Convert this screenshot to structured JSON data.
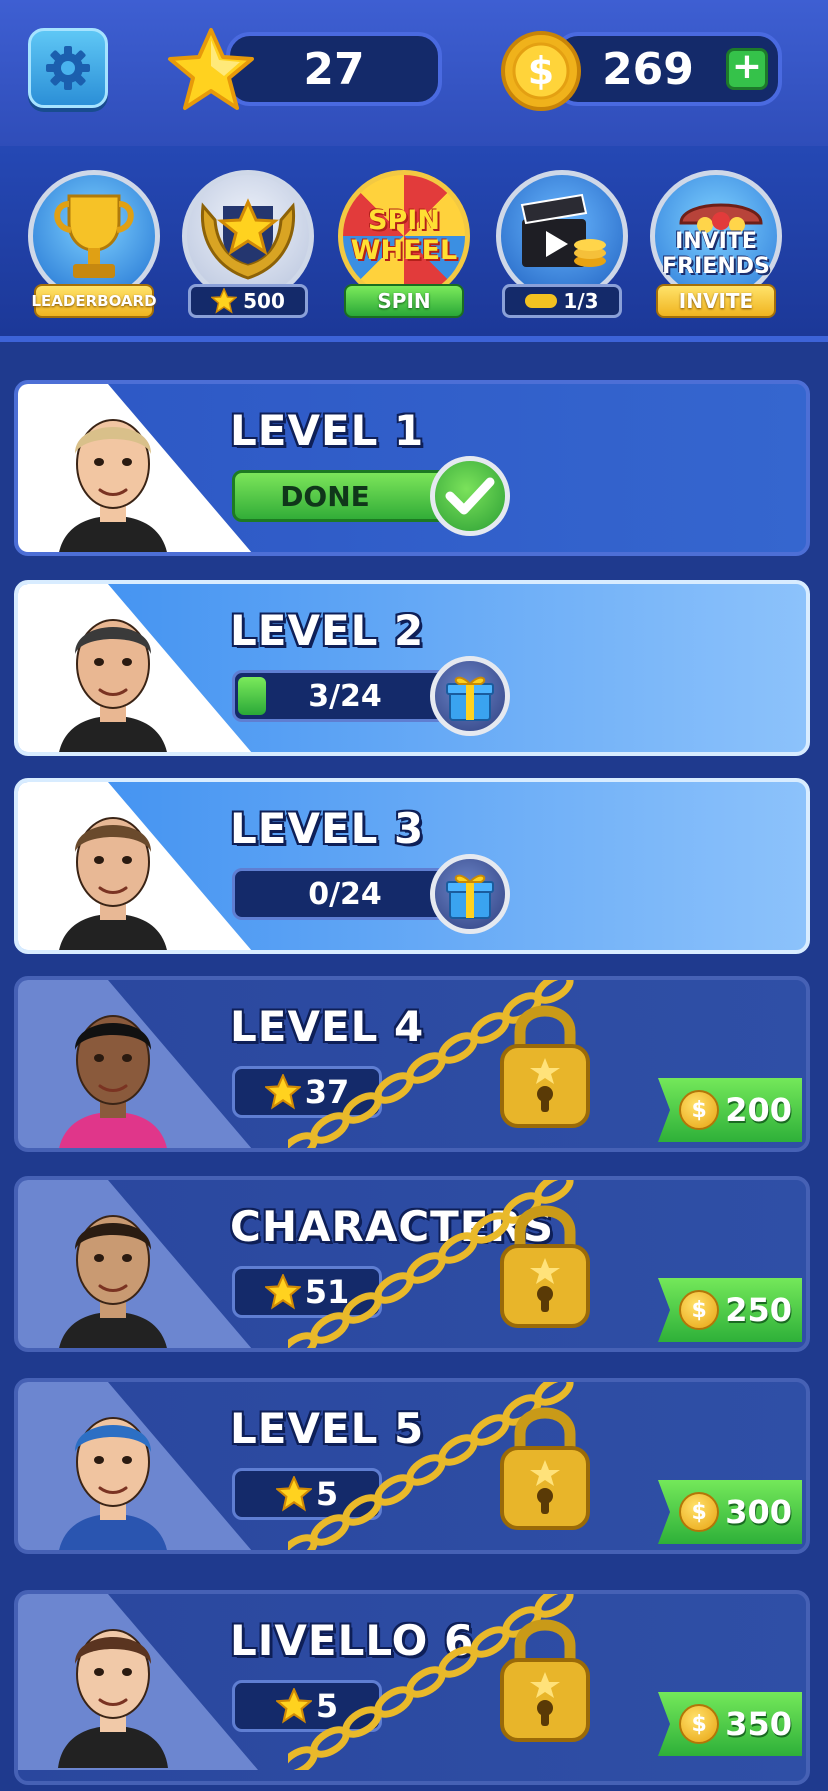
{
  "header": {
    "stars": "27",
    "coins": "269",
    "plus": "+"
  },
  "features": [
    {
      "pill": "LEADERBOARD",
      "icon": "trophy-icon"
    },
    {
      "pill": "500",
      "icon": "winged-star-badge-icon"
    },
    {
      "pill": "SPIN",
      "art_line1": "SPIN",
      "art_line2": "WHEEL",
      "icon": "spin-wheel-icon"
    },
    {
      "pill": "1/3",
      "icon": "video-coins-icon"
    },
    {
      "pill": "INVITE",
      "art_line1": "INVITE",
      "art_line2": "FRIENDS",
      "icon": "treasure-chest-icon"
    }
  ],
  "levels": [
    {
      "title": "LEVEL 1",
      "state": "done",
      "status": "DONE"
    },
    {
      "title": "LEVEL 2",
      "state": "active",
      "progress": "3/24",
      "progress_fraction": 0.125
    },
    {
      "title": "LEVEL 3",
      "state": "active",
      "progress": "0/24",
      "progress_fraction": 0
    },
    {
      "title": "LEVEL 4",
      "state": "locked",
      "stars": "37",
      "price": "200"
    },
    {
      "title": "CHARACTERS",
      "state": "locked",
      "stars": "51",
      "price": "250"
    },
    {
      "title": "LEVEL 5",
      "state": "locked",
      "stars": "5",
      "price": "300"
    },
    {
      "title": "LIVELLO 6",
      "state": "locked",
      "stars": "5",
      "price": "350"
    }
  ],
  "colors": {
    "background": "#1f3a8e",
    "accent_green": "#35c24a",
    "gold": "#f3c221"
  }
}
